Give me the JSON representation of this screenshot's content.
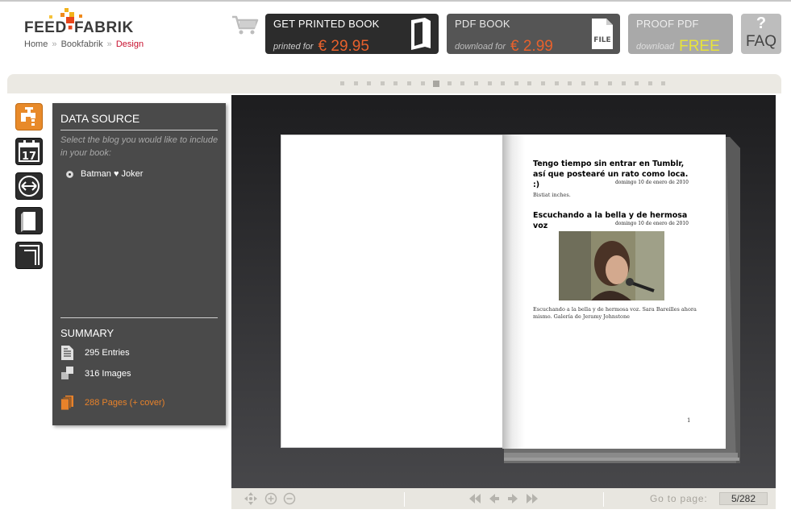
{
  "header": {
    "logo": {
      "part1": "FEED",
      "part2": "FABRIK"
    },
    "breadcrumb": {
      "home": "Home",
      "sep1": "»",
      "bookfabrik": "Bookfabrik",
      "sep2": "»",
      "current": "Design"
    }
  },
  "purchase": {
    "printed": {
      "title": "GET PRINTED BOOK",
      "sub": "printed for",
      "price": "€ 29.95"
    },
    "pdf": {
      "title": "PDF BOOK",
      "sub": "download for",
      "price": "€ 2.99",
      "icon_text": "FILE"
    },
    "proof": {
      "title": "PROOF PDF",
      "sub": "download",
      "price": "FREE"
    },
    "faq": {
      "mark": "?",
      "label": "FAQ"
    }
  },
  "page_dots": {
    "count": 25,
    "current": 7
  },
  "side_tools": [
    {
      "name": "data-source-tool",
      "icon": "faucet-icon",
      "active": true
    },
    {
      "name": "date-range-tool",
      "icon": "calendar-icon",
      "active": false,
      "text": "17"
    },
    {
      "name": "layout-tool",
      "icon": "arrows-horizontal-icon",
      "active": false
    },
    {
      "name": "cover-tool",
      "icon": "book-icon",
      "active": false
    },
    {
      "name": "format-tool",
      "icon": "corner-frame-icon",
      "active": false
    }
  ],
  "panel": {
    "data_source": {
      "heading": "DATA SOURCE",
      "hint": "Select the blog you would like to include in your book:",
      "blog": "Batman ♥ Joker"
    },
    "summary": {
      "heading": "SUMMARY",
      "entries": "295 Entries",
      "images": "316 Images",
      "pages": "288 Pages (+ cover)"
    }
  },
  "book_page": {
    "post1_title": "Tengo tiempo sin entrar en Tumblr, así que posteаré un rato como loca. :)",
    "post1_date": "domingo 10 de enero de 2010",
    "post1_body": "Bistiat inches.",
    "post2_title": "Escuchando a la bella y de hermosa voz",
    "post2_date": "domingo 10 de enero de 2010",
    "post2_caption": "Escuchando a la bella y de hermosa voz. Sara Bareilles ahora mismo. Galería de Jeramy Johnstone",
    "page_number": "1"
  },
  "toolbar": {
    "goto_label": "Go to page:",
    "goto_value": "5/282"
  },
  "colors": {
    "accent_orange": "#e8612c",
    "panel_bg": "#4a4a4a",
    "free_yellow": "#e8e33a",
    "breadcrumb_red": "#c8102e"
  }
}
